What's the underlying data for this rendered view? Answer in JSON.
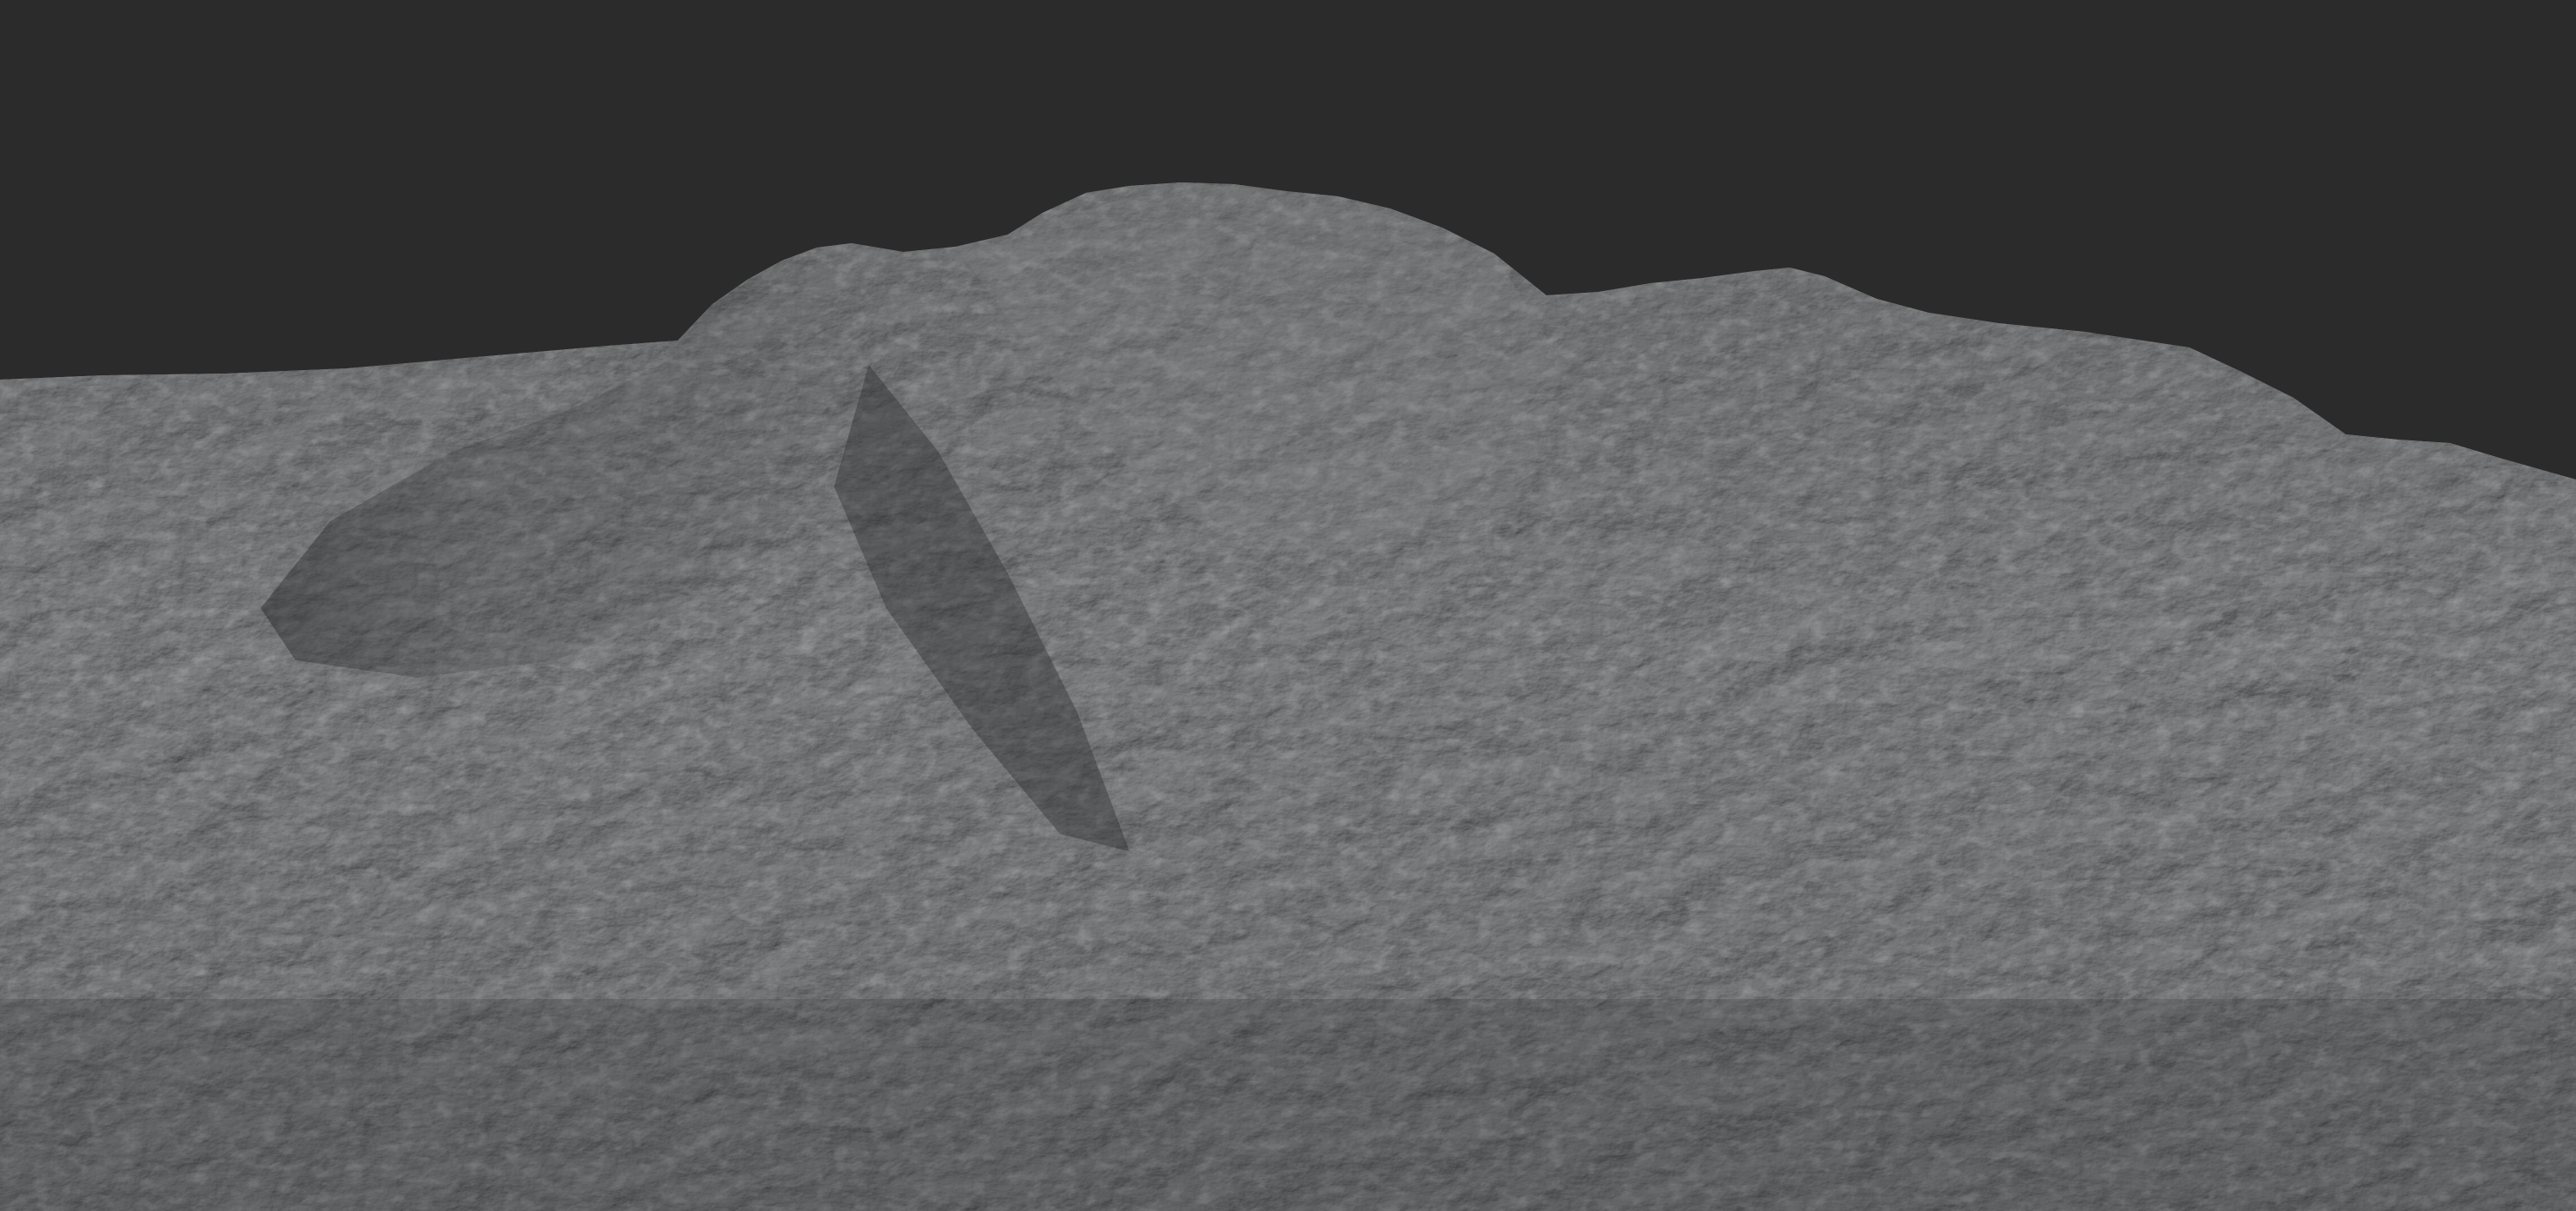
{
  "scene": {
    "background_color": "#2b2b2b",
    "terrain_base_color": "#5f6061",
    "terrain_shadow_color": "#2f3031",
    "terrain_highlight_color": "#9a9b9c",
    "subject": "mountain-terrain-render"
  }
}
